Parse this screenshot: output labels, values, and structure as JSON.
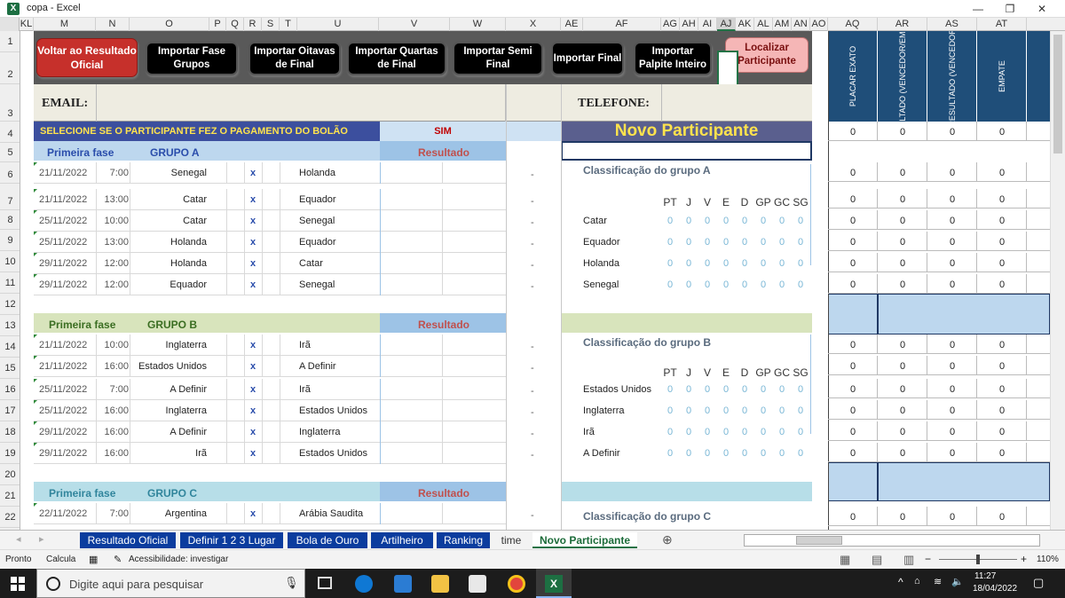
{
  "window": {
    "title": "copa - Excel",
    "minimize": "—",
    "restore": "❐",
    "close": "✕"
  },
  "columns": [
    "KL",
    "M",
    "N",
    "O",
    "P",
    "Q",
    "R",
    "S",
    "T",
    "U",
    "V",
    "W",
    "X",
    "AE",
    "AF",
    "AG",
    "AH",
    "AI",
    "AJ",
    "AK",
    "AL",
    "AM",
    "AN",
    "AO",
    "AQ",
    "AR",
    "AS",
    "AT"
  ],
  "rows": [
    "1",
    "2",
    "3",
    "4",
    "5",
    "6",
    "7",
    "8",
    "9",
    "10",
    "11",
    "12",
    "13",
    "14",
    "15",
    "16",
    "17",
    "18",
    "19",
    "20",
    "21",
    "22"
  ],
  "buttons": {
    "voltar": "Voltar ao Resultado Oficial",
    "fase_grupos": "Importar Fase Grupos",
    "oitavas": "Importar Oitavas de Final",
    "quartas": "Importar Quartas de Final",
    "semi": "Importar Semi Final",
    "final": "Importar Final",
    "palpite": "Importar Palpite Inteiro",
    "localizar": "Localizar Participante"
  },
  "form": {
    "email_label": "EMAIL:",
    "telefone_label": "TELEFONE:",
    "pagamento_label": "SELECIONE SE O PARTICIPANTE FEZ O PAGAMENTO DO BOLÃO",
    "pagamento_value": "SIM",
    "novo_participante": "Novo Participante"
  },
  "score_headers": [
    "PLACAR EXATO",
    "RESULTADO (VENCEDOR/EMPATE)",
    "RESULTADO (VENCEDOR)",
    "EMPATE"
  ],
  "groups": [
    {
      "phase": "Primeira fase",
      "name": "GRUPO A",
      "resultado": "Resultado",
      "class_title": "Classificação do grupo A",
      "stat_headers": [
        "PT",
        "J",
        "V",
        "E",
        "D",
        "GP",
        "GC",
        "SG"
      ],
      "matches": [
        {
          "date": "21/11/2022",
          "time": "7:00",
          "home": "Senegal",
          "x": "x",
          "away": "Holanda",
          "dash": "-"
        },
        {
          "date": "21/11/2022",
          "time": "13:00",
          "home": "Catar",
          "x": "x",
          "away": "Equador",
          "dash": "-"
        },
        {
          "date": "25/11/2022",
          "time": "10:00",
          "home": "Catar",
          "x": "x",
          "away": "Senegal",
          "dash": "-"
        },
        {
          "date": "25/11/2022",
          "time": "13:00",
          "home": "Holanda",
          "x": "x",
          "away": "Equador",
          "dash": "-"
        },
        {
          "date": "29/11/2022",
          "time": "12:00",
          "home": "Holanda",
          "x": "x",
          "away": "Catar",
          "dash": "-"
        },
        {
          "date": "29/11/2022",
          "time": "12:00",
          "home": "Equador",
          "x": "x",
          "away": "Senegal",
          "dash": "-"
        }
      ],
      "teams": [
        "Catar",
        "Equador",
        "Holanda",
        "Senegal"
      ]
    },
    {
      "phase": "Primeira fase",
      "name": "GRUPO B",
      "resultado": "Resultado",
      "class_title": "Classificação do grupo B",
      "stat_headers": [
        "PT",
        "J",
        "V",
        "E",
        "D",
        "GP",
        "GC",
        "SG"
      ],
      "matches": [
        {
          "date": "21/11/2022",
          "time": "10:00",
          "home": "Inglaterra",
          "x": "x",
          "away": "Irã",
          "dash": "-"
        },
        {
          "date": "21/11/2022",
          "time": "16:00",
          "home": "Estados Unidos",
          "x": "x",
          "away": "A Definir",
          "dash": "-"
        },
        {
          "date": "25/11/2022",
          "time": "7:00",
          "home": "A Definir",
          "x": "x",
          "away": "Irã",
          "dash": "-"
        },
        {
          "date": "25/11/2022",
          "time": "16:00",
          "home": "Inglaterra",
          "x": "x",
          "away": "Estados Unidos",
          "dash": "-"
        },
        {
          "date": "29/11/2022",
          "time": "16:00",
          "home": "A Definir",
          "x": "x",
          "away": "Inglaterra",
          "dash": "-"
        },
        {
          "date": "29/11/2022",
          "time": "16:00",
          "home": "Irã",
          "x": "x",
          "away": "Estados Unidos",
          "dash": "-"
        }
      ],
      "teams": [
        "Estados Unidos",
        "Inglaterra",
        "Irã",
        "A Definir"
      ]
    },
    {
      "phase": "Primeira fase",
      "name": "GRUPO C",
      "resultado": "Resultado",
      "class_title": "Classificação do grupo C",
      "matches": [
        {
          "date": "22/11/2022",
          "time": "7:00",
          "home": "Argentina",
          "x": "x",
          "away": "Arábia Saudita",
          "dash": "-"
        }
      ]
    }
  ],
  "stat_zero": "0",
  "score_zero": "0",
  "sheet_tabs": [
    "Resultado Oficial",
    "Definir 1 2 3 Lugar",
    "Bola de Ouro",
    "Artilheiro",
    "Ranking",
    "time",
    "Novo Participante"
  ],
  "status": {
    "ready": "Pronto",
    "calc": "Calcula",
    "accessibility": "Acessibilidade: investigar",
    "zoom": "110%",
    "zoom_minus": "−",
    "zoom_plus": "+"
  },
  "taskbar": {
    "search_placeholder": "Digite aqui para pesquisar",
    "time": "11:27",
    "date": "18/04/2022"
  }
}
